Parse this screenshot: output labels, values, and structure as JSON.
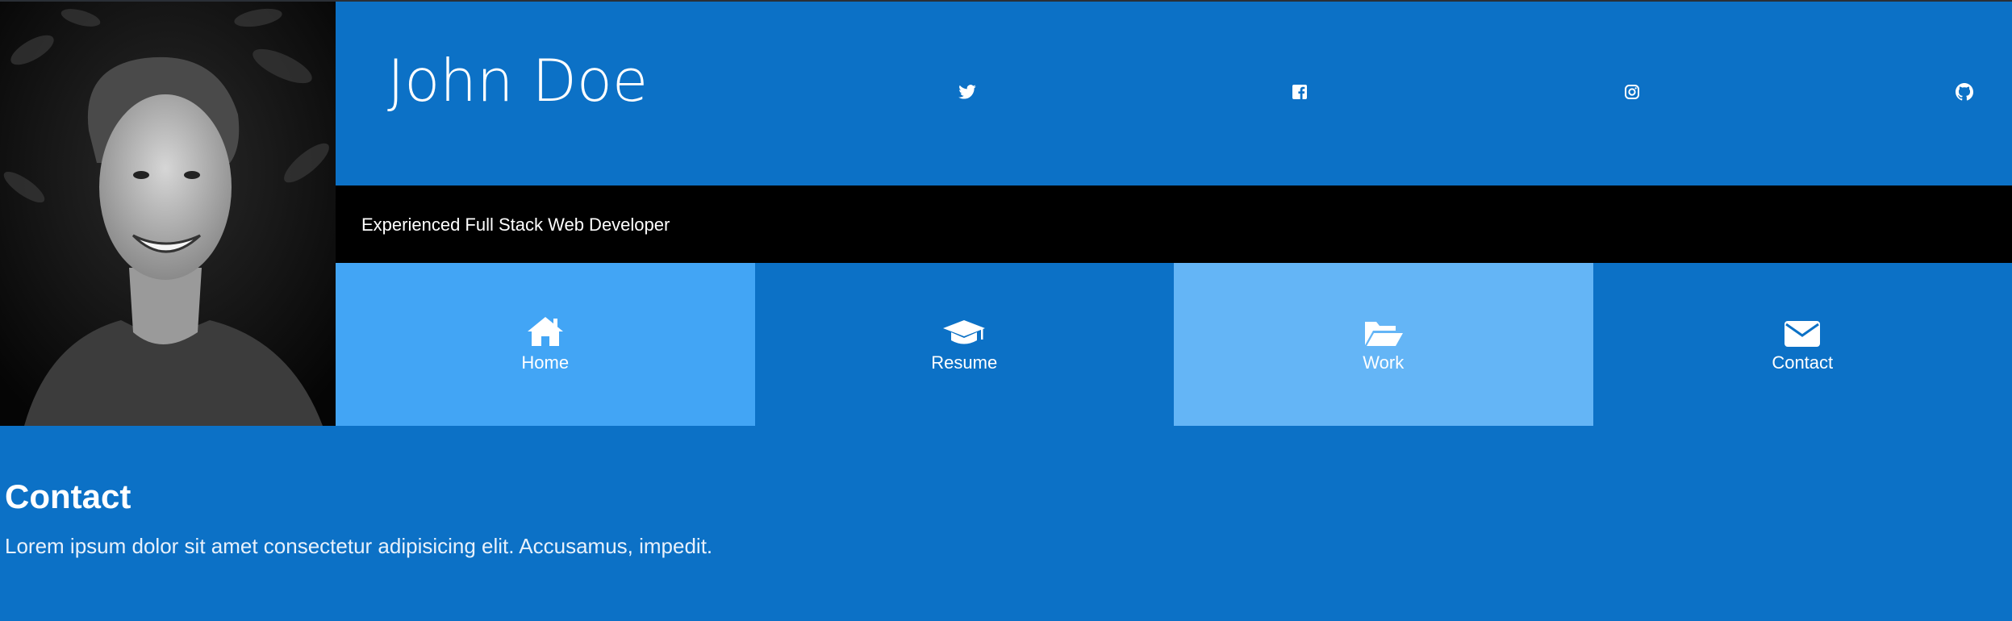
{
  "header": {
    "name": "John Doe",
    "social": [
      {
        "icon": "twitter-icon",
        "label": "Twitter"
      },
      {
        "icon": "facebook-icon",
        "label": "Facebook"
      },
      {
        "icon": "instagram-icon",
        "label": "Instagram"
      },
      {
        "icon": "github-icon",
        "label": "GitHub"
      }
    ]
  },
  "tagline": "Experienced Full Stack Web Developer",
  "nav": [
    {
      "label": "Home",
      "icon": "home-icon",
      "color": "#42a5f5"
    },
    {
      "label": "Resume",
      "icon": "graduation-cap-icon",
      "color": "#0c71c6"
    },
    {
      "label": "Work",
      "icon": "folder-open-icon",
      "color": "#64b5f6"
    },
    {
      "label": "Contact",
      "icon": "envelope-icon",
      "color": "#0c71c6"
    }
  ],
  "content": {
    "title": "Contact",
    "text": "Lorem ipsum dolor sit amet consectetur adipisicing elit. Accusamus, impedit."
  },
  "colors": {
    "primary": "#0c71c6",
    "tagline_bg": "#000000",
    "nav_home": "#42a5f5",
    "nav_work": "#64b5f6"
  }
}
